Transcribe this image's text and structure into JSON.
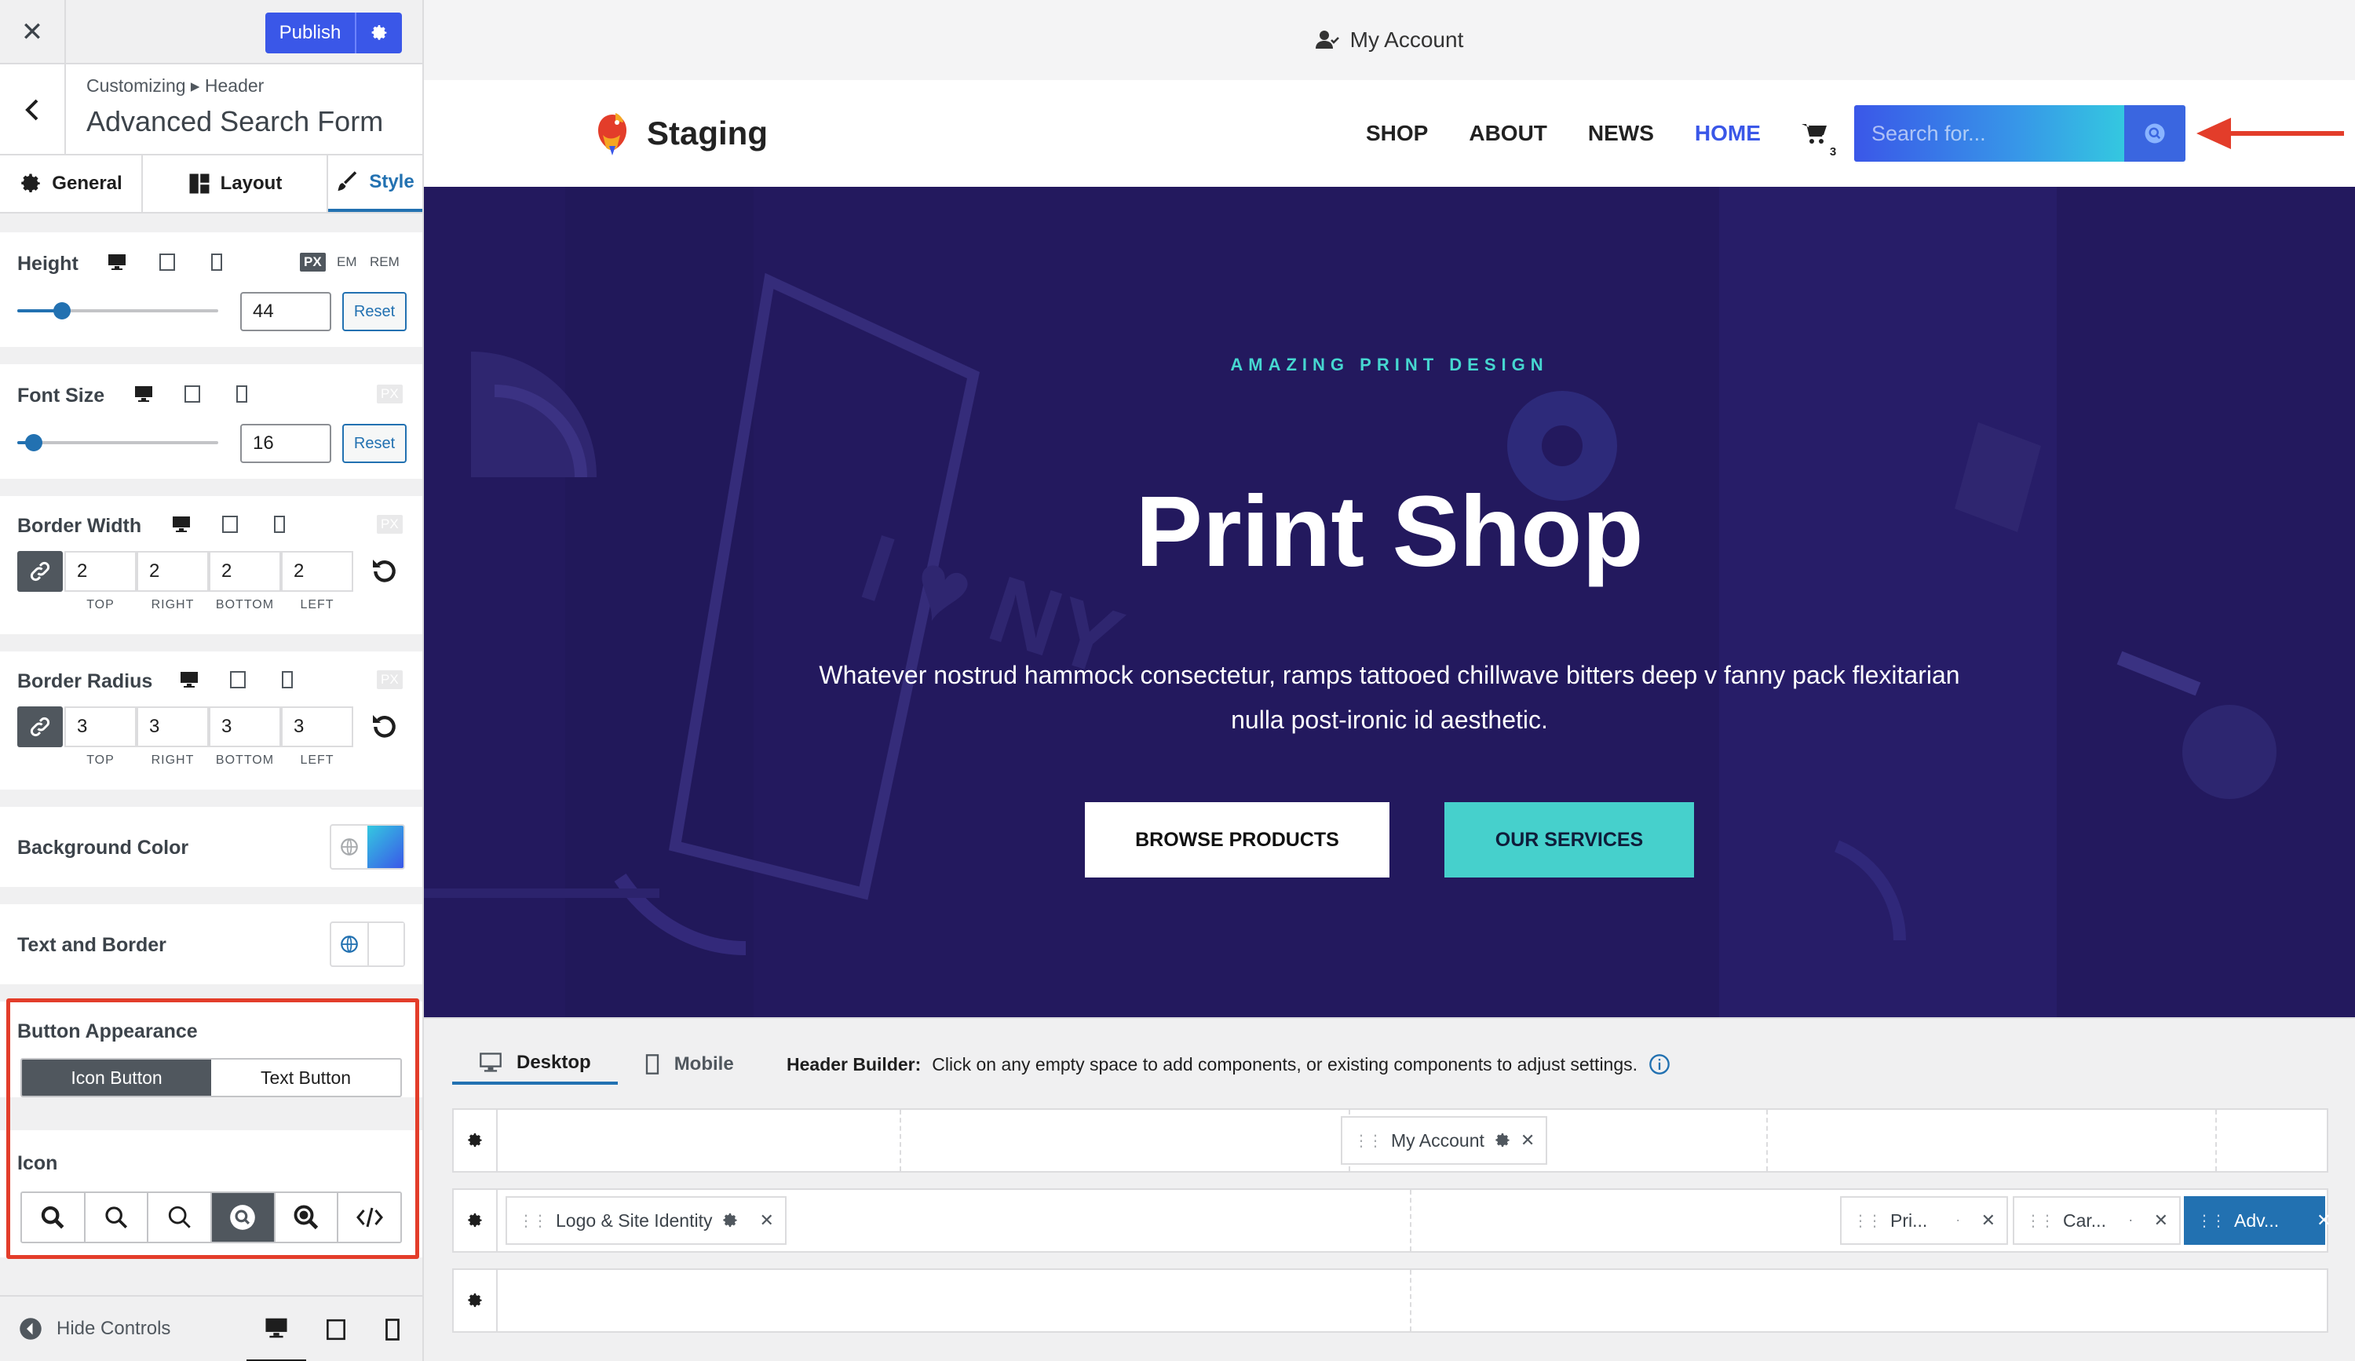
{
  "colors": {
    "accent": "#2271b1",
    "publish": "#3a57e8",
    "hero_bg": "#23195e",
    "teal": "#46d0cc",
    "highlight": "#e33d2a"
  },
  "sidebar": {
    "close_icon": "close-icon",
    "publish_label": "Publish",
    "breadcrumb": "Customizing ▸ Header",
    "title": "Advanced Search Form",
    "tabs": [
      {
        "label": "General",
        "icon": "gear-icon"
      },
      {
        "label": "Layout",
        "icon": "layout-icon"
      },
      {
        "label": "Style",
        "icon": "brush-icon"
      }
    ],
    "height": {
      "label": "Height",
      "value": "44",
      "units": [
        "PX",
        "EM",
        "REM"
      ],
      "active_unit": "PX",
      "reset": "Reset"
    },
    "font_size": {
      "label": "Font Size",
      "value": "16",
      "unit": "PX",
      "reset": "Reset"
    },
    "border_width": {
      "label": "Border Width",
      "unit": "PX",
      "values": [
        "2",
        "2",
        "2",
        "2"
      ],
      "sides": [
        "TOP",
        "RIGHT",
        "BOTTOM",
        "LEFT"
      ]
    },
    "border_radius": {
      "label": "Border Radius",
      "unit": "PX",
      "values": [
        "3",
        "3",
        "3",
        "3"
      ],
      "sides": [
        "TOP",
        "RIGHT",
        "BOTTOM",
        "LEFT"
      ]
    },
    "background_color": {
      "label": "Background Color"
    },
    "text_border": {
      "label": "Text and Border"
    },
    "button_appearance": {
      "label": "Button Appearance",
      "options": [
        "Icon Button",
        "Text Button"
      ],
      "selected": "Icon Button"
    },
    "icon": {
      "label": "Icon",
      "options": [
        "search-icon",
        "search-icon",
        "search-icon",
        "search-circle-icon",
        "search-bold-icon",
        "code-icon"
      ],
      "selected_index": 3
    },
    "hide_controls": "Hide Controls"
  },
  "preview": {
    "top_account": "My Account",
    "site_name": "Staging",
    "nav": [
      "SHOP",
      "ABOUT",
      "NEWS",
      "HOME"
    ],
    "nav_current": "HOME",
    "cart_count": "3",
    "search_placeholder": "Search for...",
    "hero": {
      "eyebrow": "AMAZING PRINT DESIGN",
      "title": "Print Shop",
      "text": "Whatever nostrud hammock consectetur, ramps tattooed chillwave bitters deep v fanny pack flexitarian nulla post-ironic id aesthetic.",
      "btn_primary": "BROWSE PRODUCTS",
      "btn_secondary": "OUR SERVICES"
    }
  },
  "builder": {
    "tabs": [
      "Desktop",
      "Mobile"
    ],
    "info_bold": "Header Builder:",
    "info_text": "Click on any empty space to add components, or existing components to adjust settings.",
    "row1_chip": "My Account",
    "row2_chips": [
      "Logo & Site Identity",
      "Pri...",
      "Car...",
      "Adv..."
    ]
  }
}
